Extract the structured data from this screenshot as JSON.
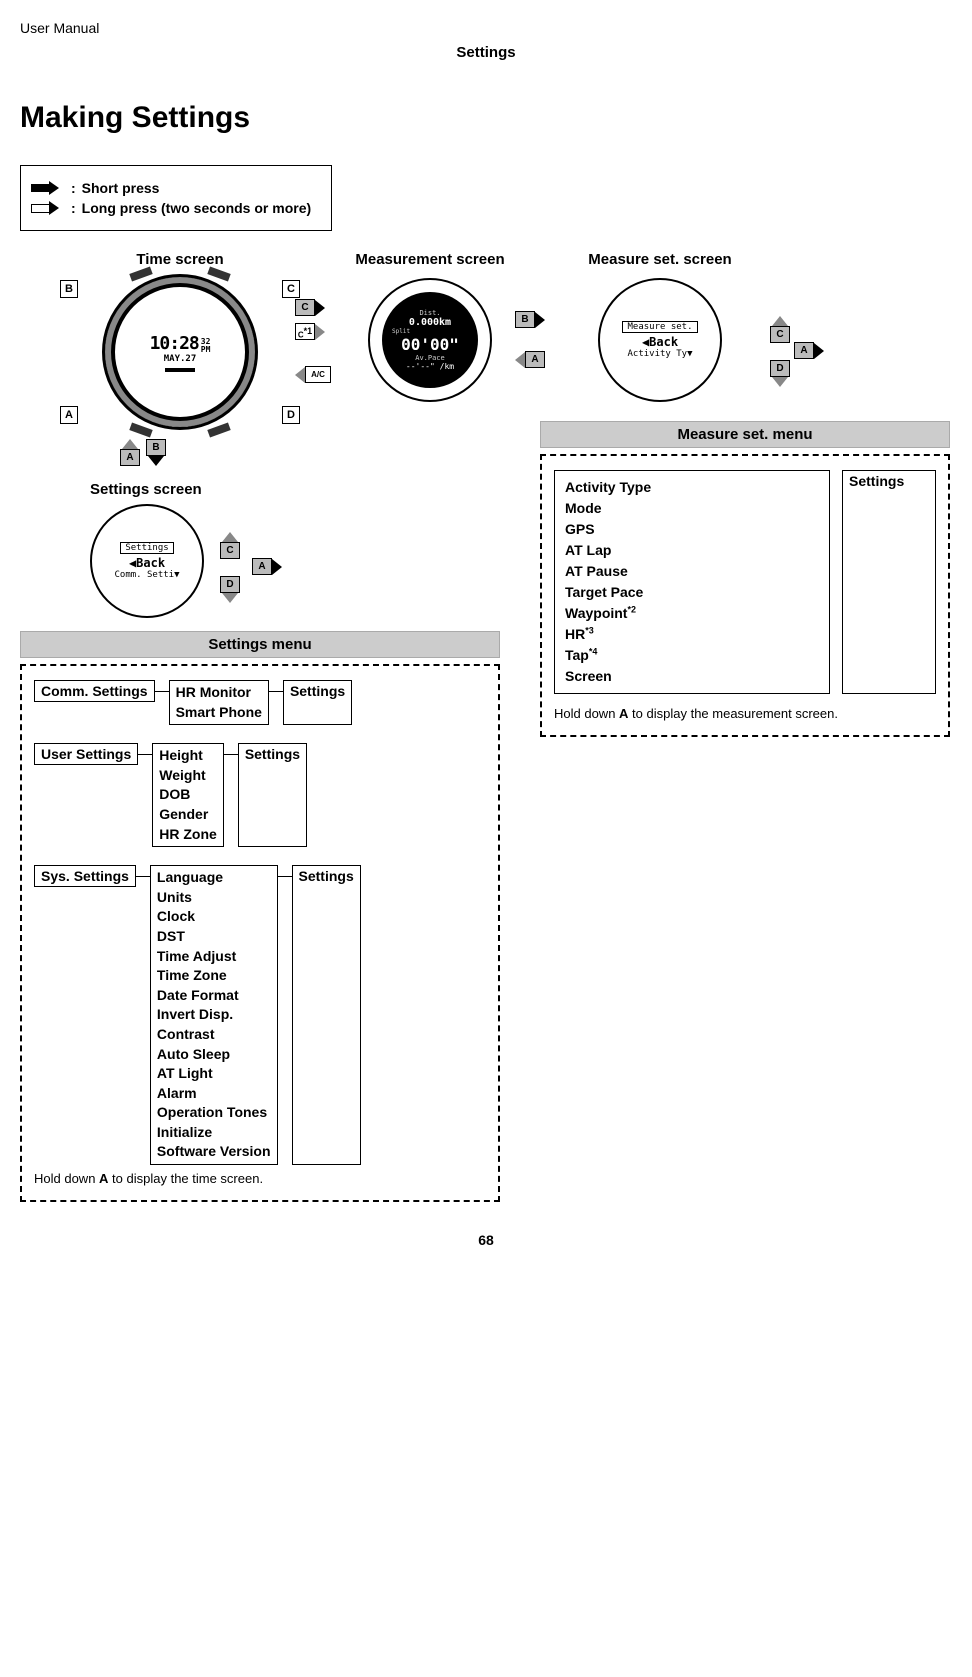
{
  "header": {
    "manual": "User Manual",
    "section": "Settings"
  },
  "title": "Making Settings",
  "legend": {
    "short": "Short press",
    "long": "Long press (two seconds or more)"
  },
  "screens": {
    "time_label": "Time screen",
    "measurement_label": "Measurement screen",
    "measure_set_label": "Measure set. screen",
    "settings_screen_label": "Settings screen"
  },
  "watch": {
    "time": "10:28",
    "ampm": "32\nPM",
    "date": "MAY.27",
    "meas_dist_label": "Dist.",
    "meas_dist": "0.000km",
    "meas_split_label": "Split",
    "meas_big": "00'00\"",
    "meas_pace_label": "Av.Pace",
    "meas_pace": "--'--\" /km",
    "measure_set_top": "Measure set.",
    "measure_set_mid": "◀Back",
    "measure_set_bot": "Activity Ty▼",
    "settings_top": "Settings",
    "settings_mid": "◀Back",
    "settings_bot": "Comm. Setti▼"
  },
  "keys": {
    "A": "A",
    "B": "B",
    "C": "C",
    "D": "D",
    "Cstar": "C*1",
    "AC": "A/C"
  },
  "settings_menu": {
    "title": "Settings menu",
    "comm_label": "Comm. Settings",
    "comm_items": [
      "HR Monitor",
      "Smart Phone"
    ],
    "user_label": "User Settings",
    "user_items": [
      "Height",
      "Weight",
      "DOB",
      "Gender",
      "HR Zone"
    ],
    "sys_label": "Sys. Settings",
    "sys_items": [
      "Language",
      "Units",
      "Clock",
      "DST",
      "Time Adjust",
      "Time Zone",
      "Date Format",
      "Invert Disp.",
      "Contrast",
      "Auto Sleep",
      "AT Light",
      "Alarm",
      "Operation Tones",
      "Initialize",
      "Software Version"
    ],
    "settings_label": "Settings",
    "hold_note_pre": "Hold down ",
    "hold_note_key": "A",
    "hold_note_post": " to display the time screen."
  },
  "measure_menu": {
    "title": "Measure set. menu",
    "items": [
      "Activity Type",
      "Mode",
      "GPS",
      "AT Lap",
      "AT Pause",
      "Target Pace",
      "Waypoint*2",
      "HR*3",
      "Tap*4",
      "Screen"
    ],
    "settings_label": "Settings",
    "hold_note_pre": "Hold down ",
    "hold_note_key": "A",
    "hold_note_post": " to display the measurement screen."
  },
  "page_number": "68"
}
